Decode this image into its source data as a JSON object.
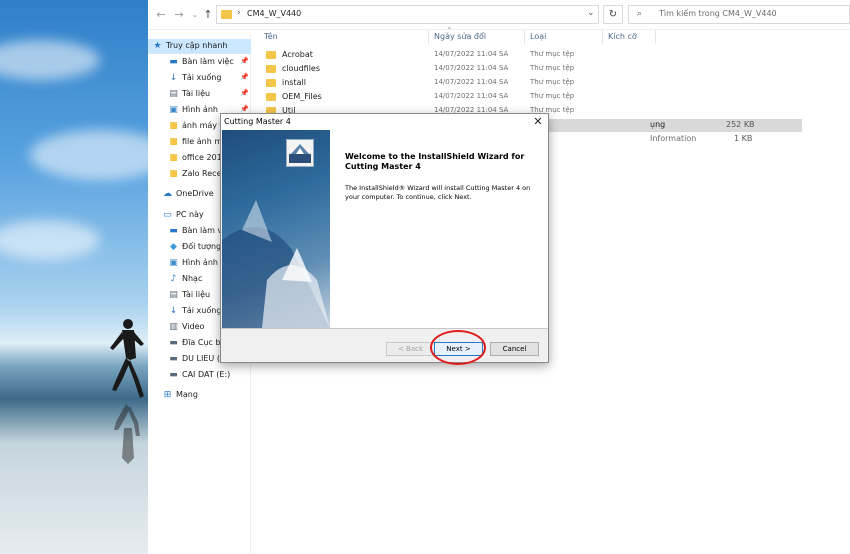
{
  "explorer": {
    "address_path": "CM4_W_V440",
    "search_placeholder": "Tìm kiếm trong CM4_W_V440",
    "columns": {
      "name": "Tên",
      "date": "Ngày sửa đổi",
      "type": "Loại",
      "size": "Kích cỡ"
    },
    "files": [
      {
        "name": "Acrobat",
        "date": "14/07/2022 11:04 SA",
        "type": "Thư mục tệp"
      },
      {
        "name": "cloudfiles",
        "date": "14/07/2022 11:04 SA",
        "type": "Thư mục tệp"
      },
      {
        "name": "install",
        "date": "14/07/2022 11:04 SA",
        "type": "Thư mục tệp"
      },
      {
        "name": "OEM_Files",
        "date": "14/07/2022 11:04 SA",
        "type": "Thư mục tệp"
      },
      {
        "name": "Util",
        "date": "14/07/2022 11:04 SA",
        "type": "Thư mục tệp"
      }
    ],
    "partial_rows": [
      {
        "type": "ụng",
        "size": "252 KB"
      },
      {
        "type": "Information",
        "size": "1 KB"
      }
    ]
  },
  "navpane": {
    "quick_access": "Truy cập nhanh",
    "quick_items": [
      {
        "label": "Bàn làm việc",
        "icon": "desktop-icon",
        "pinned": true
      },
      {
        "label": "Tải xuống",
        "icon": "download-icon",
        "pinned": true
      },
      {
        "label": "Tài liệu",
        "icon": "document-icon",
        "pinned": true
      },
      {
        "label": "Hình ảnh",
        "icon": "picture-icon",
        "pinned": true
      },
      {
        "label": "ảnh máy th",
        "icon": "folder-icon",
        "pinned": false
      },
      {
        "label": "file ảnh má",
        "icon": "folder-icon",
        "pinned": false
      },
      {
        "label": "office 2010",
        "icon": "folder-icon",
        "pinned": false
      },
      {
        "label": "Zalo Receiv",
        "icon": "folder-icon",
        "pinned": false
      }
    ],
    "onedrive": "OneDrive",
    "this_pc": "PC này",
    "pc_items": [
      {
        "label": "Bàn làm việc",
        "icon": "desktop-icon"
      },
      {
        "label": "Đối tượng 3",
        "icon": "cube-icon"
      },
      {
        "label": "Hình ảnh",
        "icon": "picture-icon"
      },
      {
        "label": "Nhạc",
        "icon": "music-icon"
      },
      {
        "label": "Tài liệu",
        "icon": "document-icon"
      },
      {
        "label": "Tải xuống",
        "icon": "download-icon"
      },
      {
        "label": "Video",
        "icon": "video-icon"
      },
      {
        "label": "Đĩa Cục bộ",
        "icon": "drive-icon"
      },
      {
        "label": "DU LIEU (D:",
        "icon": "drive-icon"
      },
      {
        "label": "CAI DAT (E:)",
        "icon": "drive-icon"
      }
    ],
    "network": "Mạng"
  },
  "dialog": {
    "title": "Cutting Master 4",
    "heading": "Welcome to the InstallShield Wizard for Cutting Master 4",
    "body": "The InstallShield® Wizard will install Cutting Master 4 on your computer.  To continue, click Next.",
    "back_label": "< Back",
    "next_label": "Next >",
    "cancel_label": "Cancel"
  },
  "colors": {
    "highlight": "#e01b1b",
    "selection": "#cce8ff",
    "folder": "#f3c64a"
  }
}
